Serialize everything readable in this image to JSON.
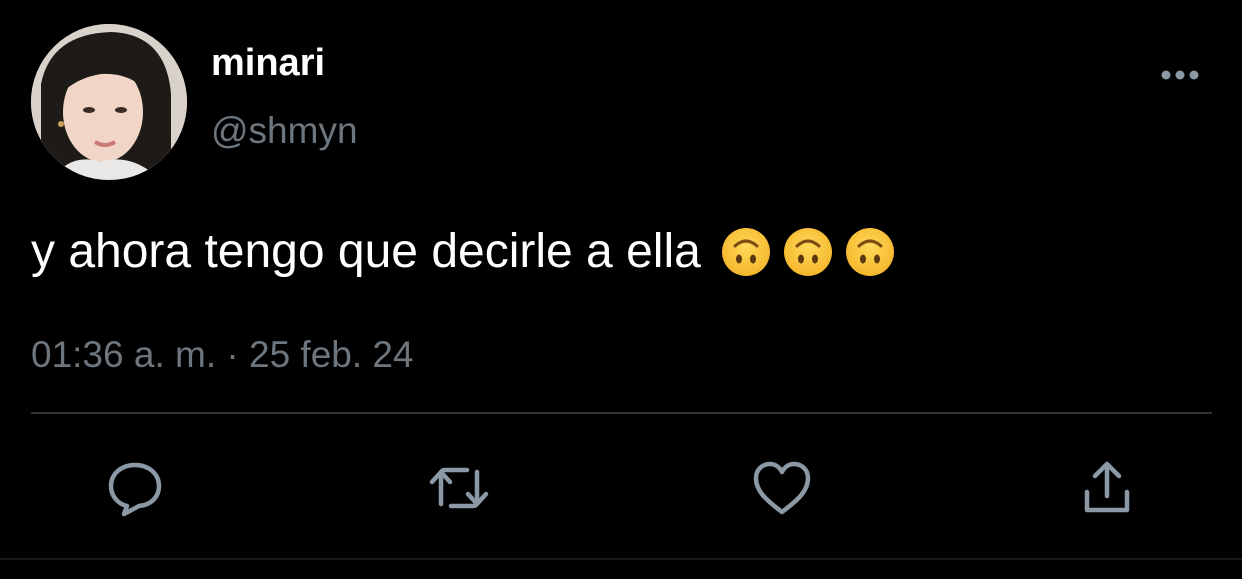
{
  "tweet": {
    "display_name": "minari",
    "handle": "@shmyn",
    "text": "y ahora tengo que decirle a ella",
    "emojis": [
      "upside-down-face-emoji",
      "upside-down-face-emoji",
      "upside-down-face-emoji"
    ],
    "timestamp": "01:36 a. m. · 25 feb. 24"
  },
  "actions": {
    "reply_icon": "reply-icon",
    "retweet_icon": "retweet-icon",
    "like_icon": "heart-icon",
    "share_icon": "share-icon",
    "more_icon": "more-dots-icon"
  },
  "colors": {
    "background": "#000000",
    "primary_text": "#ffffff",
    "secondary_text": "#6e767d",
    "divider": "#2f3336",
    "emoji": "#f7c33a"
  }
}
